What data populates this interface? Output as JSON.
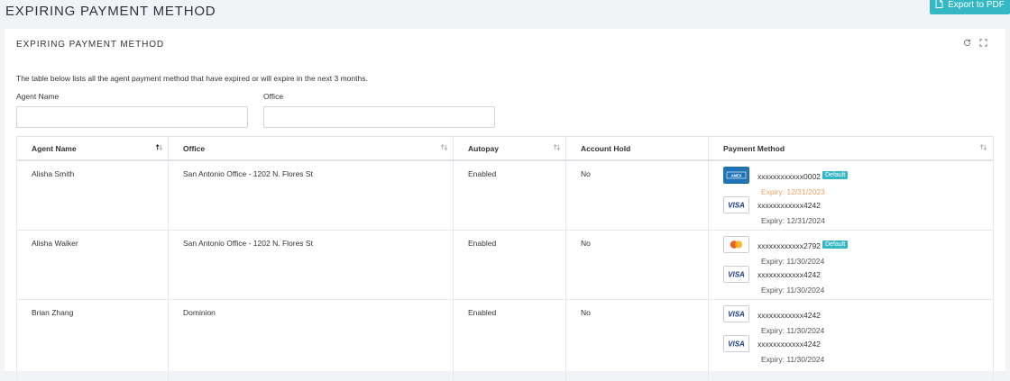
{
  "page": {
    "title": "EXPIRING PAYMENT METHOD",
    "export_label": "Export to PDF"
  },
  "panel": {
    "title": "EXPIRING PAYMENT METHOD",
    "description": "The table below lists all the agent payment method that have expired or will expire in the next 3 months.",
    "filters": {
      "agent_name_label": "Agent Name",
      "agent_name_value": "",
      "office_label": "Office",
      "office_value": ""
    }
  },
  "table": {
    "columns": [
      "Agent Name",
      "Office",
      "Autopay",
      "Account Hold",
      "Payment Method"
    ],
    "rows": [
      {
        "agent": "Alisha Smith",
        "office": "San Antonio Office - 1202 N. Flores St",
        "autopay": "Enabled",
        "hold": "No",
        "methods": [
          {
            "brand": "amex-card-icon",
            "number": "xxxxxxxxxxxx0002",
            "default": "Default",
            "expiry": "Expiry: 12/31/2023",
            "expired": true
          },
          {
            "brand": "visa-card-icon",
            "number": "xxxxxxxxxxxx4242",
            "expiry": "Expiry: 12/31/2024",
            "expired": false
          }
        ]
      },
      {
        "agent": "Alisha Walker",
        "office": "San Antonio Office - 1202 N. Flores St",
        "autopay": "Enabled",
        "hold": "No",
        "methods": [
          {
            "brand": "mastercard-card-icon",
            "number": "xxxxxxxxxxxx2792",
            "default": "Default",
            "expiry": "Expiry: 11/30/2024",
            "expired": false
          },
          {
            "brand": "visa-card-icon",
            "number": "xxxxxxxxxxxx4242",
            "expiry": "Expiry: 11/30/2024",
            "expired": false
          }
        ]
      },
      {
        "agent": "Brian Zhang",
        "office": "Dominion",
        "autopay": "Enabled",
        "hold": "No",
        "methods": [
          {
            "brand": "visa-card-icon",
            "number": "xxxxxxxxxxxx4242",
            "expiry": "Expiry: 11/30/2024",
            "expired": false
          },
          {
            "brand": "visa-card-icon",
            "number": "xxxxxxxxxxxx4242",
            "expiry": "Expiry: 11/30/2024",
            "expired": false
          }
        ]
      }
    ]
  },
  "colors": {
    "accent": "#35b8c4",
    "expired_text": "#f0a060",
    "page_bg": "#f1f3f6"
  },
  "icons": {
    "export": "file-icon",
    "refresh": "refresh-icon",
    "expand": "expand-icon",
    "sort": "sort-icon",
    "sort_active": "sort-asc-icon"
  }
}
